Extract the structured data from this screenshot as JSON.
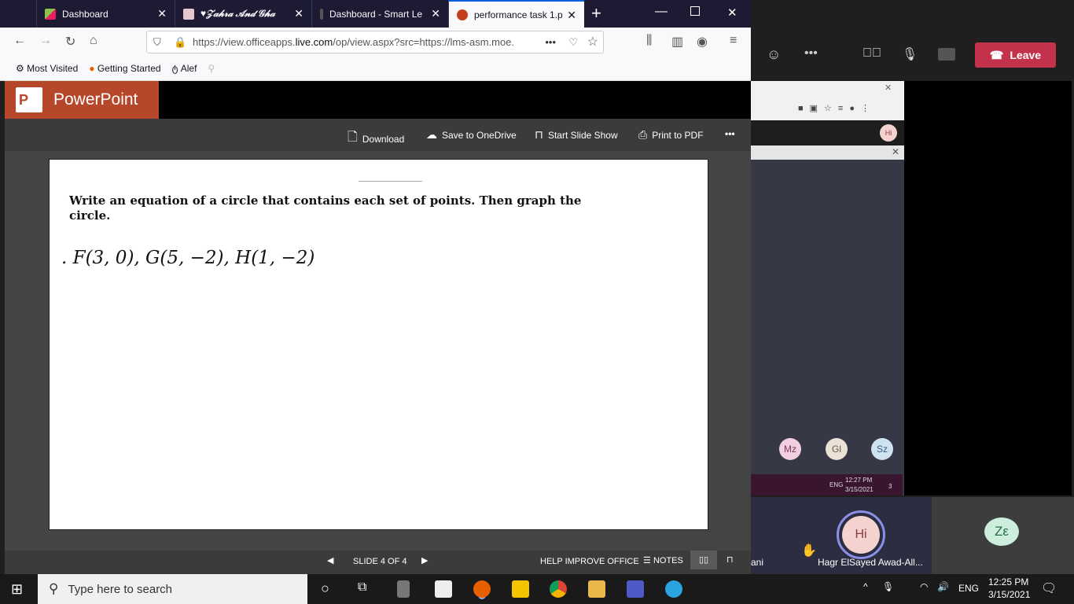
{
  "browser": {
    "tabs": [
      {
        "label": "Dashboard",
        "active": false
      },
      {
        "label": "♥𝒵𝒶𝒽𝓇𝒶 𝒜𝓃𝒹 𝒢𝒽𝒶",
        "active": false
      },
      {
        "label": "Dashboard - Smart Le",
        "active": false
      },
      {
        "label": "performance task 1.p",
        "active": true
      }
    ],
    "new_tab": "+",
    "url_prefix": "https://view.officeapps.",
    "url_domain": "live.com",
    "url_rest": "/op/view.aspx?src=https://lms-asm.moe.",
    "bookmarks": [
      "Most Visited",
      "Getting Started",
      "Alef"
    ]
  },
  "ppt": {
    "app_name": "PowerPoint",
    "logo_letter": "P",
    "toolbar": {
      "download": "Download",
      "save": "Save to OneDrive",
      "slideshow": "Start Slide Show",
      "print": "Print to PDF",
      "more": "•••"
    },
    "slide": {
      "line": "________________",
      "instruction": "Write an equation of a circle that contains each set of points. Then graph the circle.",
      "problem": ". F(3, 0), G(5, −2), H(1, −2)"
    },
    "status": {
      "slide_counter": "SLIDE 4 OF 4",
      "help": "HELP IMPROVE OFFICE",
      "notes": "NOTES"
    }
  },
  "teams": {
    "leave": "Leave",
    "nested": {
      "avatar_top": "Hi",
      "participants": [
        "Mz",
        "Gl",
        "Sz"
      ],
      "tray_lang": "ENG",
      "tray_time": "12:27 PM",
      "tray_date": "3/15/2021",
      "tray_badge": "3"
    },
    "tiles": [
      {
        "avatar": "Hi",
        "name": "Hagr ElSayed Awad-All...",
        "left_cut": "ani"
      },
      {
        "avatar": "Zε"
      }
    ]
  },
  "taskbar": {
    "search_placeholder": "Type here to search",
    "lang": "ENG",
    "time": "12:25 PM",
    "date": "3/15/2021"
  },
  "colors": {
    "ppt_brand": "#b7472a",
    "leave": "#c4314b",
    "firefox_accent": "#0060df"
  }
}
